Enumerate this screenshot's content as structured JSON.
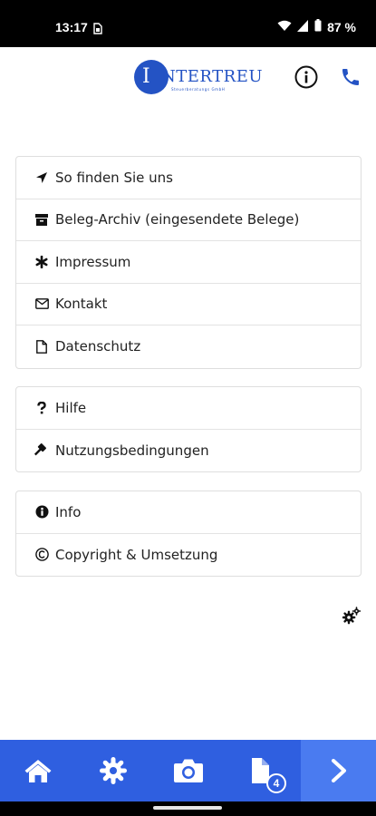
{
  "status_bar": {
    "time": "13:17",
    "battery": "87 %",
    "icons": [
      "sim-icon",
      "wifi-icon",
      "signal-icon",
      "battery-icon"
    ]
  },
  "header": {
    "logo_letter": "I",
    "logo_word": "NTERTREU",
    "logo_tagline": "Steuerberatungs GmbH",
    "info_icon": "info-circle-icon",
    "phone_icon": "phone-icon",
    "brand_color": "#2453c4"
  },
  "menu": {
    "group1": [
      {
        "icon": "location-arrow-icon",
        "label": "So finden Sie uns"
      },
      {
        "icon": "archive-icon",
        "label": "Beleg-Archiv (eingesendete Belege)"
      },
      {
        "icon": "asterisk-icon",
        "label": "Impressum"
      },
      {
        "icon": "envelope-icon",
        "label": "Kontakt"
      },
      {
        "icon": "document-icon",
        "label": "Datenschutz"
      }
    ],
    "group2": [
      {
        "icon": "question-icon",
        "label": "Hilfe"
      },
      {
        "icon": "gavel-icon",
        "label": "Nutzungsbedingungen"
      }
    ],
    "group3": [
      {
        "icon": "info-icon",
        "label": "Info"
      },
      {
        "icon": "copyright-icon",
        "label": "Copyright & Umsetzung"
      }
    ]
  },
  "settings_icon": "cogs-icon",
  "tabbar": {
    "accent": "#2f5fe0",
    "tabs": [
      {
        "icon": "home-icon"
      },
      {
        "icon": "gear-icon"
      },
      {
        "icon": "camera-icon"
      },
      {
        "icon": "documents-icon",
        "badge": "4"
      },
      {
        "icon": "chevron-right-icon"
      }
    ]
  }
}
